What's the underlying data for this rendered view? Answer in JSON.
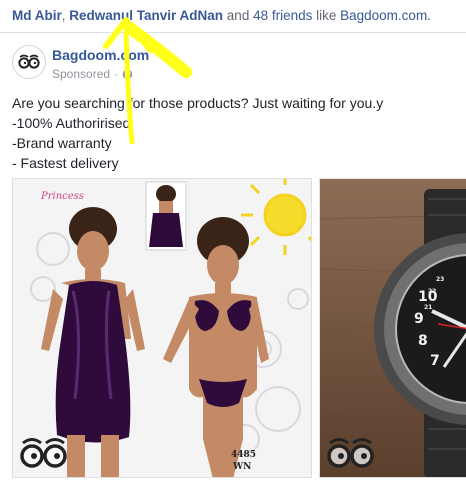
{
  "social": {
    "friend_1": "Md Abir",
    "separator": ", ",
    "friend_2": "Redwanul Tanvir AdNan",
    "connector": " and ",
    "friends_count_text": "48 friends",
    "like_text": " like ",
    "page_link": "Bagdoom.com."
  },
  "post": {
    "page_name": "Bagdoom.com",
    "sponsored": "Sponsored",
    "dot": "·",
    "text_lines": [
      "Are you searching for those products? Just waiting for you.y",
      "-100% Authorirised",
      "-Brand warranty",
      "- Fastest delivery"
    ]
  },
  "carousel": {
    "card_1": {
      "brand_script": "Princess",
      "product_code": "4485",
      "product_size": "WN"
    },
    "card_2": {
      "watch_numbers": [
        "10",
        "9",
        "8",
        "7",
        "23",
        "22",
        "21"
      ]
    }
  },
  "colors": {
    "link": "#385898",
    "annotation_arrow": "#ffff1a",
    "satin_purple": "#2f0b3c"
  },
  "icons": {
    "page_logo": "bagdoom-logo-icon",
    "audience": "globe-icon",
    "arrow": "yellow-annotation-arrow"
  }
}
